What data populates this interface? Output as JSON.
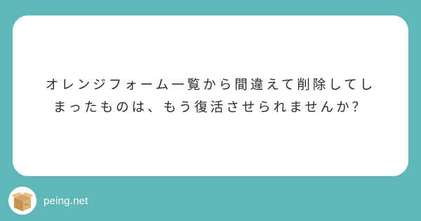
{
  "question": {
    "line1": "オレンジフォーム一覧から間違えて削除してし",
    "line2": "まったものは、もう復活させられませんか？"
  },
  "footer": {
    "site": "peing.net",
    "logo_icon": "cardboard-box-icon"
  },
  "colors": {
    "background": "#5fb7b8",
    "card": "#ffffff",
    "text": "#2a2a2a",
    "box": "#d6a567"
  }
}
